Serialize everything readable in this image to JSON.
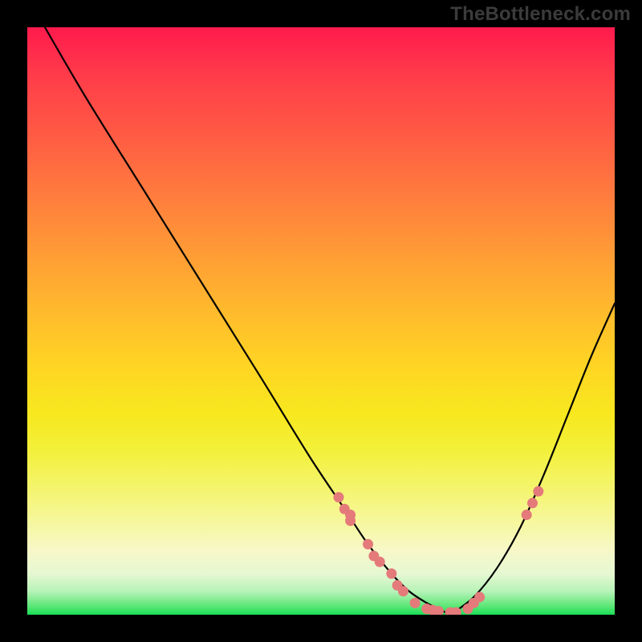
{
  "watermark": "TheBottleneck.com",
  "colors": {
    "background": "#000000",
    "curve": "#000000",
    "dot": "#e47a7a"
  },
  "chart_data": {
    "type": "line",
    "title": "",
    "xlabel": "",
    "ylabel": "",
    "xlim": [
      0,
      100
    ],
    "ylim": [
      0,
      100
    ],
    "series": [
      {
        "name": "left-curve",
        "x": [
          3,
          10,
          20,
          30,
          40,
          48,
          54,
          58,
          62,
          65,
          68,
          70,
          72
        ],
        "y": [
          100,
          88,
          72,
          56,
          40,
          27,
          18,
          12,
          7,
          4,
          2,
          1,
          0
        ]
      },
      {
        "name": "right-curve",
        "x": [
          72,
          76,
          80,
          84,
          88,
          92,
          96,
          100
        ],
        "y": [
          0,
          3,
          8,
          15,
          24,
          34,
          44,
          53
        ]
      }
    ],
    "markers": [
      {
        "series": "left-curve",
        "x": 53,
        "y": 20
      },
      {
        "series": "left-curve",
        "x": 54,
        "y": 18
      },
      {
        "series": "left-curve",
        "x": 55,
        "y": 17
      },
      {
        "series": "left-curve",
        "x": 55,
        "y": 16
      },
      {
        "series": "left-curve",
        "x": 58,
        "y": 12
      },
      {
        "series": "left-curve",
        "x": 59,
        "y": 10
      },
      {
        "series": "left-curve",
        "x": 60,
        "y": 9
      },
      {
        "series": "left-curve",
        "x": 62,
        "y": 7
      },
      {
        "series": "left-curve",
        "x": 63,
        "y": 5
      },
      {
        "series": "left-curve",
        "x": 64,
        "y": 4
      },
      {
        "series": "left-curve",
        "x": 66,
        "y": 2
      },
      {
        "series": "left-curve",
        "x": 68,
        "y": 1
      },
      {
        "series": "left-curve",
        "x": 69,
        "y": 0.8
      },
      {
        "series": "left-curve",
        "x": 70,
        "y": 0.6
      },
      {
        "series": "left-curve",
        "x": 72,
        "y": 0.4
      },
      {
        "series": "left-curve",
        "x": 73,
        "y": 0.4
      },
      {
        "series": "right-curve",
        "x": 75,
        "y": 1
      },
      {
        "series": "right-curve",
        "x": 76,
        "y": 2
      },
      {
        "series": "right-curve",
        "x": 77,
        "y": 3
      },
      {
        "series": "right-curve",
        "x": 85,
        "y": 17
      },
      {
        "series": "right-curve",
        "x": 86,
        "y": 19
      },
      {
        "series": "right-curve",
        "x": 87,
        "y": 21
      }
    ]
  }
}
